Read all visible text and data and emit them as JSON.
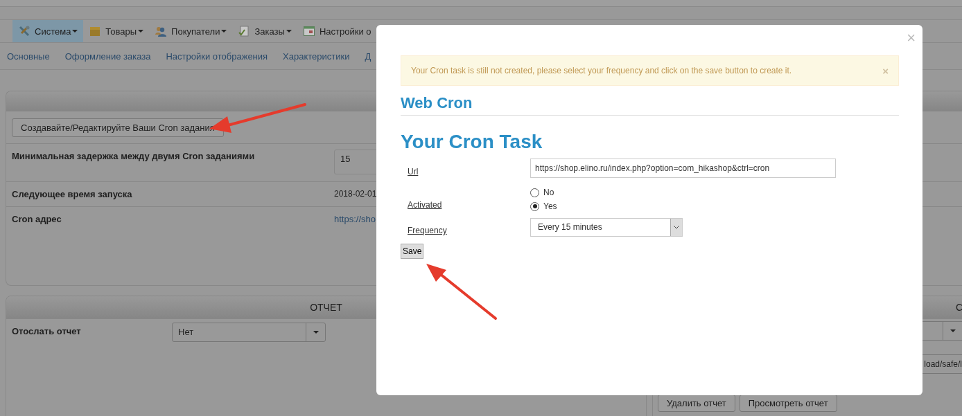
{
  "menu": [
    {
      "label": "Система",
      "selected": true,
      "dropdown": true
    },
    {
      "label": "Товары",
      "selected": false,
      "dropdown": true
    },
    {
      "label": "Покупатели",
      "selected": false,
      "dropdown": true
    },
    {
      "label": "Заказы",
      "selected": false,
      "dropdown": true
    },
    {
      "label": "Настройки о",
      "selected": false,
      "dropdown": false
    }
  ],
  "tabs": [
    "Основные",
    "Оформление заказа",
    "Настройки отображения",
    "Характеристики",
    "Д"
  ],
  "cron_panel": {
    "button": "Создавайте/Редактируйте Ваши Cron задания",
    "rows": [
      {
        "label": "Минимальная задержка между двумя Cron заданиями",
        "kind": "input",
        "value": "15"
      },
      {
        "label": "Следующее время запуска",
        "kind": "text",
        "value": "2018-02-01"
      },
      {
        "label": "Cron адрес",
        "kind": "link",
        "value": "https://sho"
      }
    ]
  },
  "report_panel": {
    "title": "ОТЧЕТ",
    "rows": [
      {
        "label": "Отослать отчет",
        "value": "Нет"
      }
    ]
  },
  "side_panel": {
    "title": "С",
    "field": "load/safe/l",
    "buttons": [
      "Удалить отчет",
      "Просмотреть отчет"
    ]
  },
  "modal": {
    "close": "×",
    "alert_close": "×",
    "alert": "Your Cron task is still not created, please select your frequency and click on the save button to create it.",
    "heading": "Web Cron",
    "subheading": "Your Cron Task",
    "fields": [
      {
        "label": "Url",
        "kind": "text",
        "value": "https://shop.elino.ru/index.php?option=com_hikashop&ctrl=cron"
      },
      {
        "label": "Activated",
        "kind": "radio",
        "options": [
          {
            "label": "No",
            "selected": false
          },
          {
            "label": "Yes",
            "selected": true
          }
        ]
      },
      {
        "label": "Frequency",
        "kind": "select",
        "value": "Every 15 minutes"
      }
    ],
    "save": "Save"
  }
}
